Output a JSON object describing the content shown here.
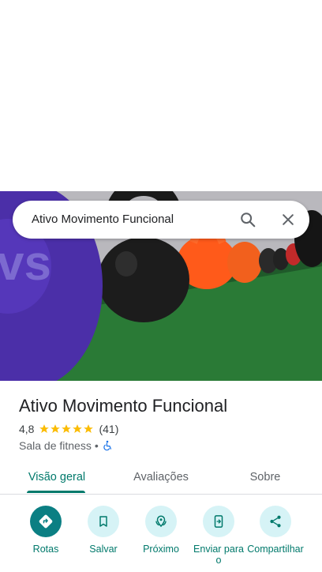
{
  "search": {
    "query": "Ativo Movimento Funcional"
  },
  "place": {
    "name": "Ativo Movimento Funcional",
    "rating": "4,8",
    "rating_value": 4.8,
    "stars_max": 5,
    "review_count": "(41)",
    "category": "Sala de fitness",
    "separator": "•",
    "accessibility_icon": "wheelchair-icon"
  },
  "tabs": [
    {
      "label": "Visão geral",
      "active": true
    },
    {
      "label": "Avaliações",
      "active": false
    },
    {
      "label": "Sobre",
      "active": false
    }
  ],
  "actions": [
    {
      "label": "Rotas",
      "icon": "directions-icon"
    },
    {
      "label": "Salvar",
      "icon": "bookmark-icon"
    },
    {
      "label": "Próximo",
      "icon": "nearby-icon"
    },
    {
      "label": "Enviar para o",
      "icon": "send-to-phone-icon"
    },
    {
      "label": "Compartilhar",
      "icon": "share-icon"
    }
  ],
  "colors": {
    "accent": "#00796b",
    "primary_button": "#0b7f83",
    "tonal_button": "#d6f3f6",
    "star": "#fbbc04"
  }
}
